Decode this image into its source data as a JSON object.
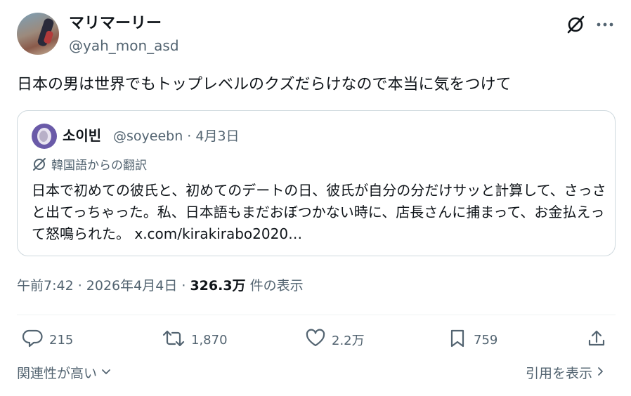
{
  "author": {
    "display_name": "マリマーリー",
    "handle": "@yah_mon_asd"
  },
  "tweet": {
    "text": "日本の男は世界でもトップレベルのクズだらけなので本当に気をつけて"
  },
  "quote": {
    "display_name": "소이빈",
    "meta": "@soyeebn · 4月3日",
    "translate_label": "韓国語からの翻訳",
    "body": "日本で初めての彼氏と、初めてのデートの日、彼氏が自分の分だけサッと計算して、さっさと出てっちゃった。私、日本語もまだおぼつかない時に、店長さんに捕まって、お金払えって怒鳴られた。",
    "link": "x.com/kirakirabo2020…"
  },
  "timestamp": {
    "datetime": "午前7:42 · 2026年4月4日 · ",
    "views": "326.3万",
    "views_label": " 件の表示"
  },
  "actions": {
    "reply_count": "215",
    "retweet_count": "1,870",
    "like_count": "2.2万",
    "bookmark_count": "759"
  },
  "footer": {
    "related_label": "関連性が高い",
    "quotes_label": "引用を表示"
  },
  "colors": {
    "text": "#0f1419",
    "secondary": "#536471",
    "border": "#cfd9de"
  },
  "icons": [
    "grok-icon",
    "more-icon",
    "translate-icon",
    "reply-icon",
    "retweet-icon",
    "like-icon",
    "bookmark-icon",
    "share-icon",
    "chevron-down-icon",
    "chevron-right-icon"
  ]
}
